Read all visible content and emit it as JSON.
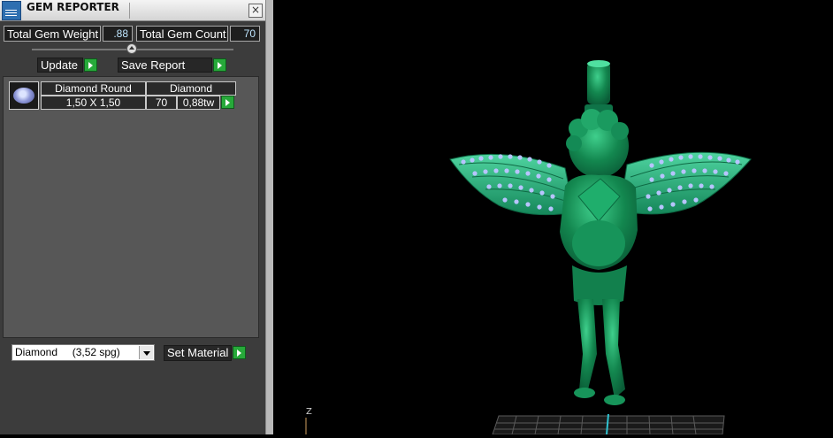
{
  "window": {
    "title": "GEM REPORTER",
    "close_glyph": "×"
  },
  "summary": {
    "weight_label": "Total Gem Weight",
    "weight_value": ".88",
    "count_label": "Total Gem Count",
    "count_value": "70"
  },
  "actions": {
    "update_label": "Update",
    "save_label": "Save Report"
  },
  "gem_list": {
    "rows": [
      {
        "shape": "Diamond Round",
        "material": "Diamond",
        "size": "1,50 X 1,50",
        "count": "70",
        "weight": "0,88tw"
      }
    ]
  },
  "material": {
    "selected": "Diamond     (3,52 spg)",
    "set_label": "Set Material"
  },
  "viewport": {
    "axis_label": "Z"
  },
  "colors": {
    "accent_green": "#27a93a",
    "model_green": "#138a55",
    "gem_blue": "#b7c4ff"
  },
  "icons": [
    "app-icon",
    "close-icon",
    "slider-knob-icon",
    "play-arrow-icon",
    "gem-icon",
    "chevron-down-icon"
  ]
}
